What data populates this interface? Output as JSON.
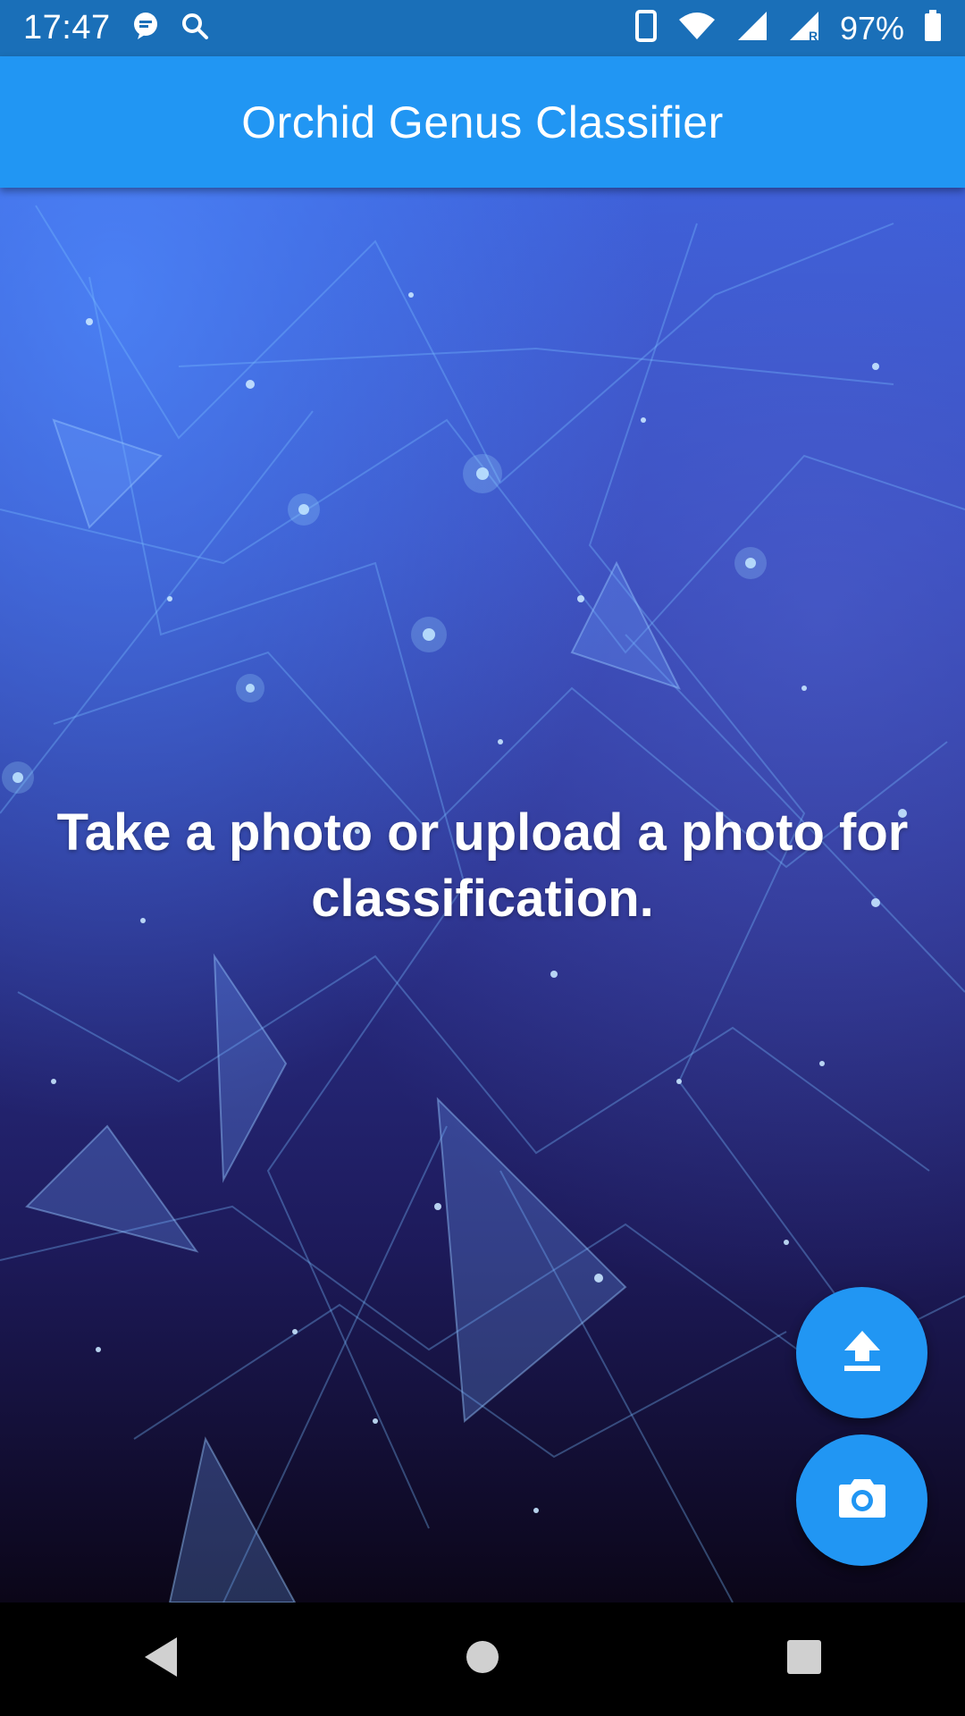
{
  "status_bar": {
    "time": "17:47",
    "battery_percent": "97%",
    "icons": [
      "chat-notification-icon",
      "search-icon",
      "phone-vibrate-icon",
      "wifi-icon",
      "cell-signal-icon",
      "cell-signal-roaming-icon",
      "battery-icon"
    ]
  },
  "app_bar": {
    "title": "Orchid Genus Classifier"
  },
  "main": {
    "prompt": "Take a photo or upload a photo for classification."
  },
  "fabs": {
    "upload_icon": "upload-icon",
    "camera_icon": "camera-icon"
  },
  "nav_bar": {
    "items": [
      "back-icon",
      "home-icon",
      "recents-icon"
    ]
  },
  "colors": {
    "status_bar": "#1a6fb8",
    "app_bar": "#2196f3",
    "fab": "#2196f3",
    "nav_bar": "#000000"
  }
}
